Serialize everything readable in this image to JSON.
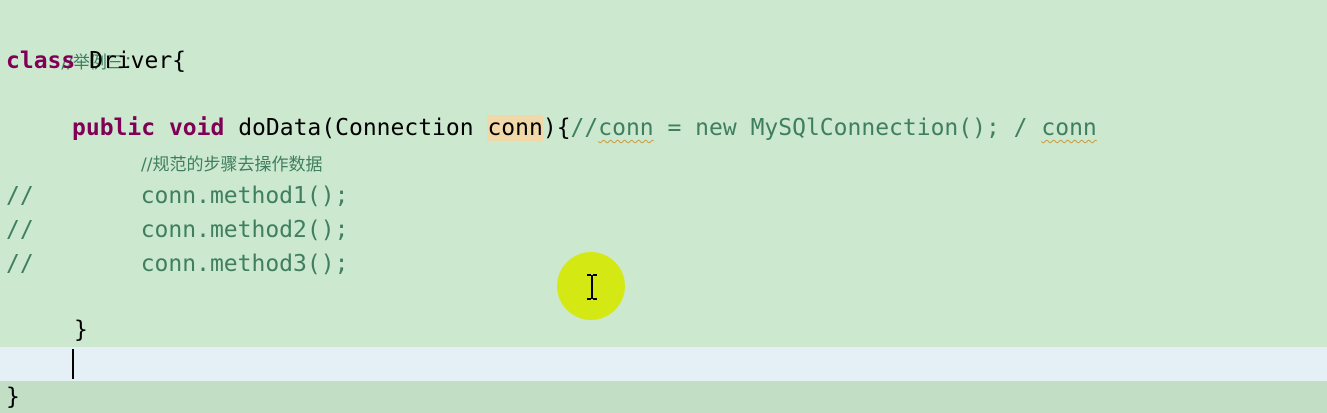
{
  "editor": {
    "language": "java",
    "colors": {
      "background": "#cce8cf",
      "keyword": "#7f0055",
      "comment": "#3f7f5f",
      "occurrence_highlight": "#f0d8a8",
      "current_line": "#e4eff6",
      "mouse_highlight": "#d4e80a"
    },
    "lines": {
      "l1": {
        "comment": "//举例三："
      },
      "l2": {
        "kw_class": "class",
        "name": " Driver{"
      },
      "l4": {
        "kw_public": "public",
        "kw_void": "void",
        "method_sig": " doData(Connection ",
        "param": "conn",
        "after_param": "){",
        "comment_start": "//",
        "comment_conn1": "conn",
        "comment_mid": " = new MySQlConnection(); / ",
        "comment_conn2": "conn"
      },
      "l5": {
        "comment": "//规范的步骤去操作数据"
      },
      "l6": {
        "prefix": "//",
        "code": "conn.method1();"
      },
      "l7": {
        "prefix": "//",
        "code": "conn.method2();"
      },
      "l8": {
        "prefix": "//",
        "code": "conn.method3();"
      },
      "l10": {
        "brace": "}"
      },
      "l12": {
        "brace": "}"
      }
    },
    "cursor_icon": "i-beam-cursor-icon"
  }
}
